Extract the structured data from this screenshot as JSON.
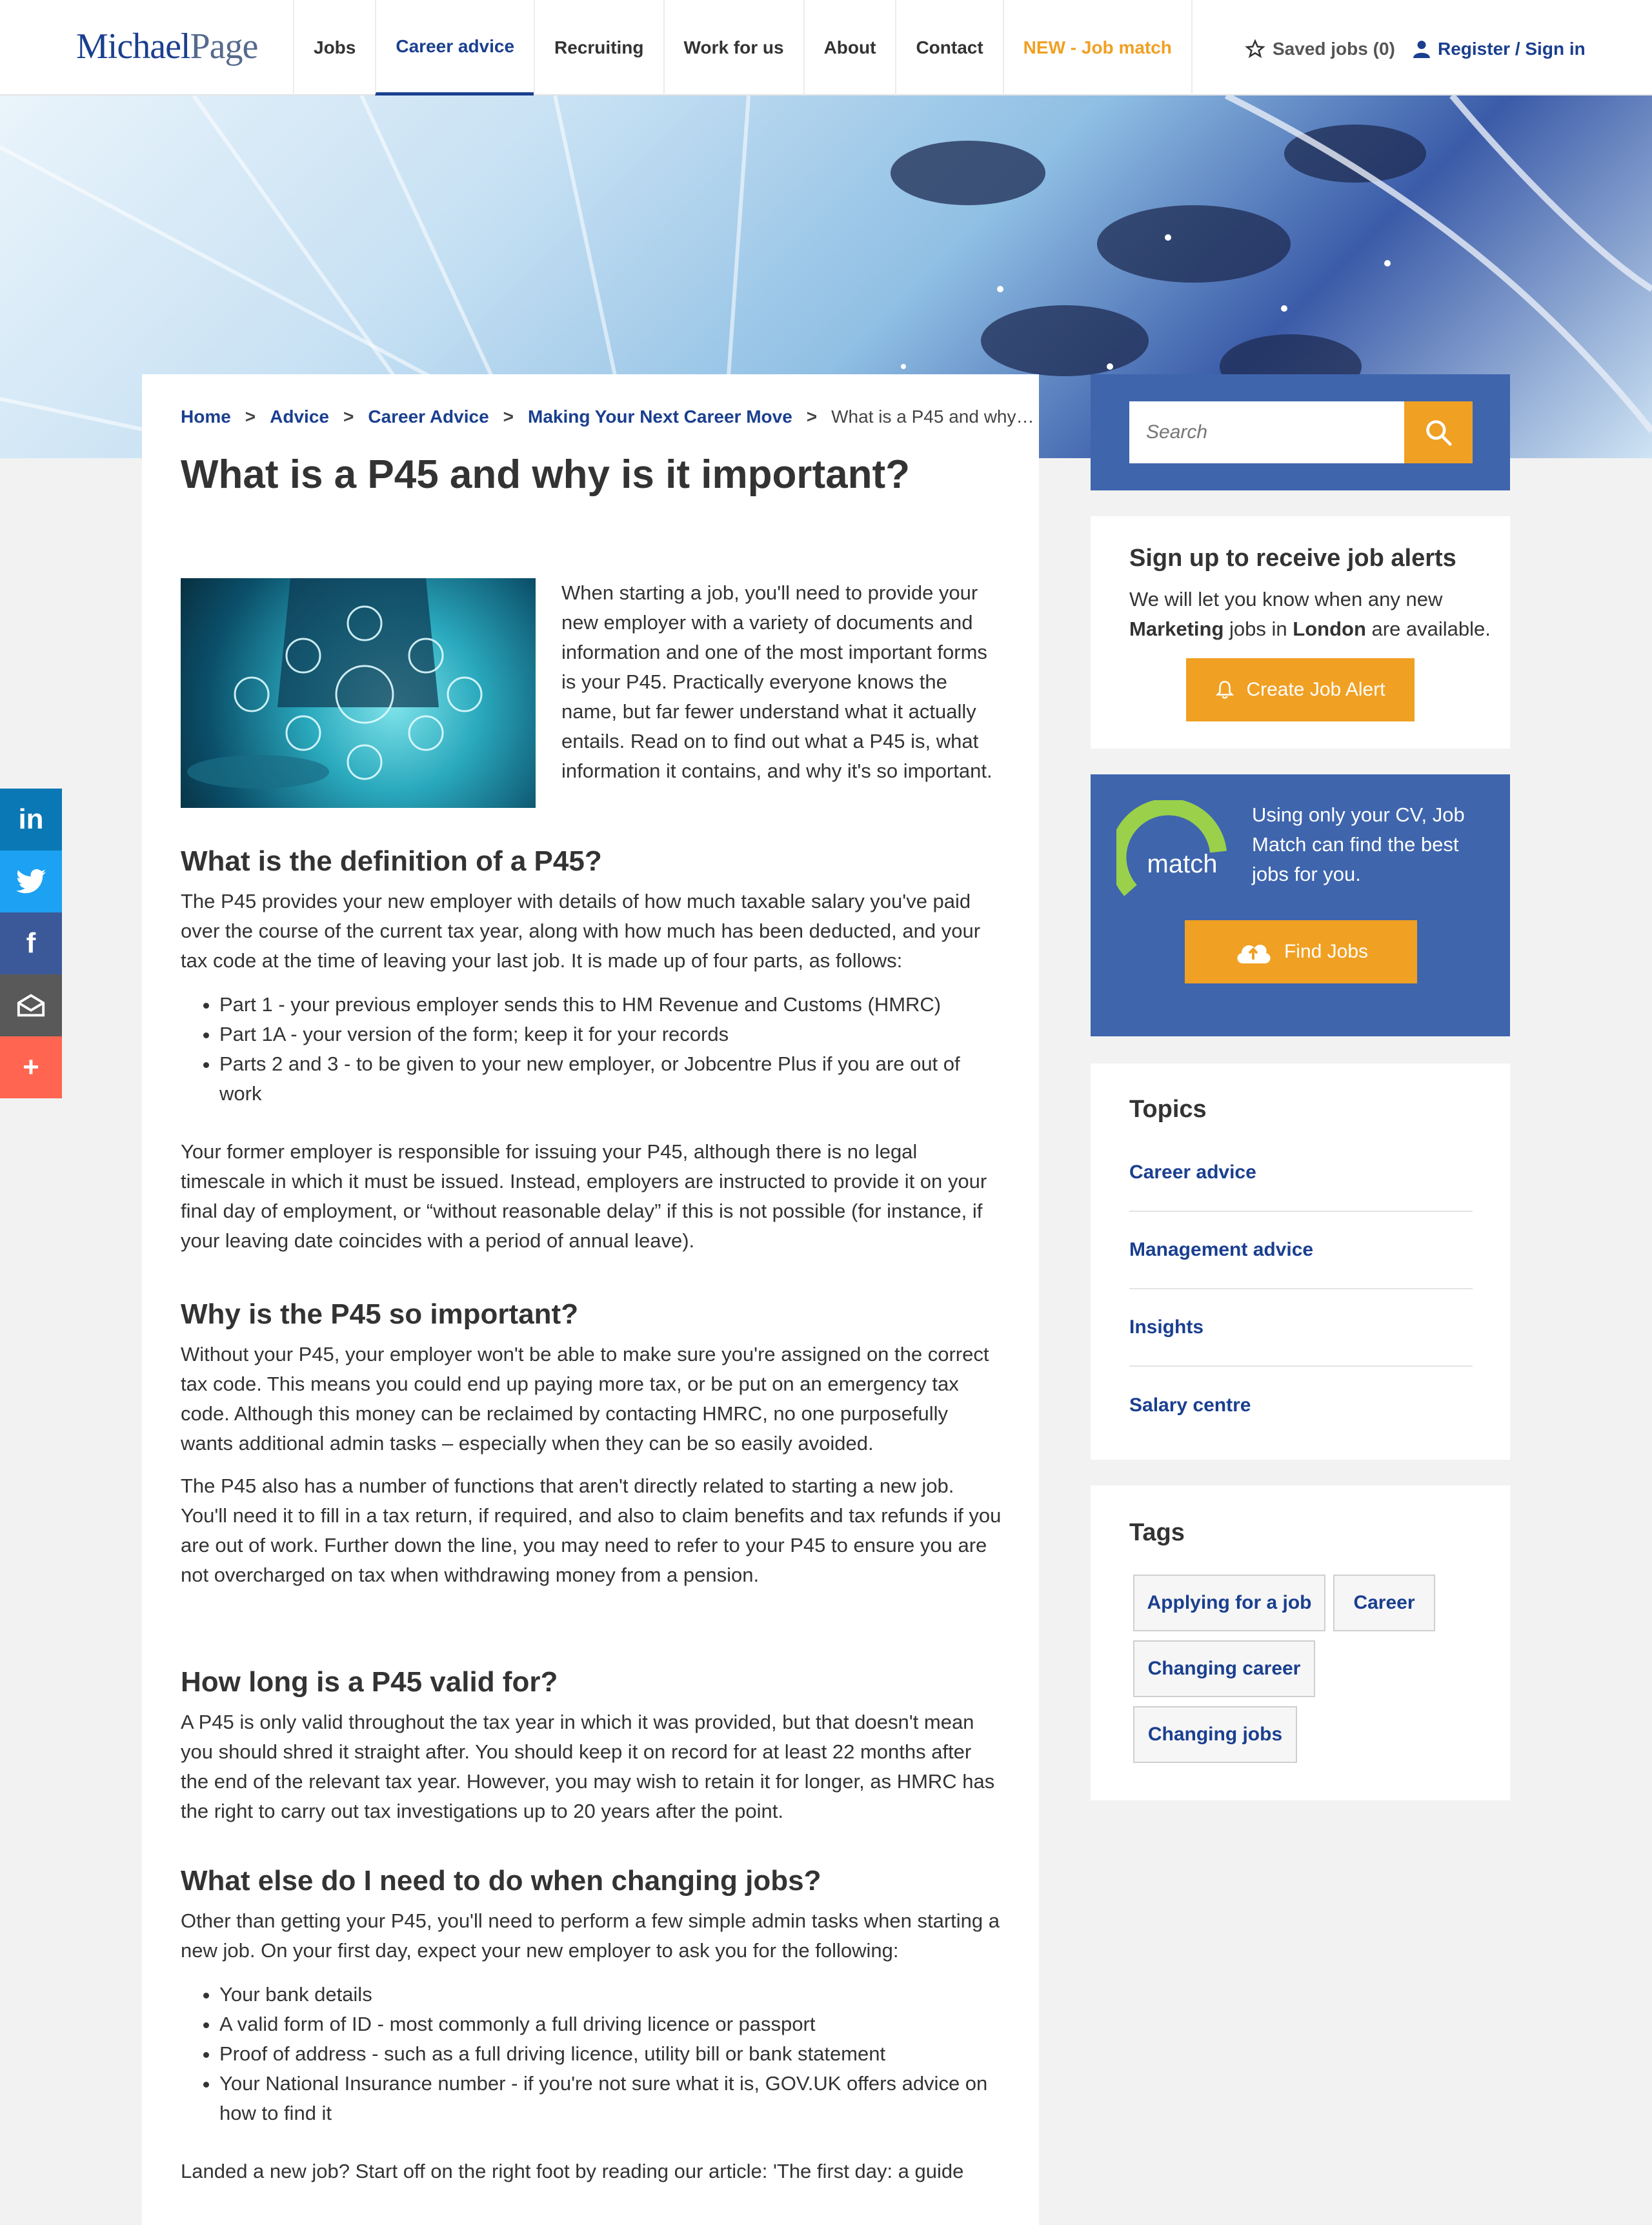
{
  "header": {
    "logo_michael": "Michael",
    "logo_page": "Page",
    "nav": [
      "Jobs",
      "Career advice",
      "Recruiting",
      "Work for us",
      "About",
      "Contact",
      "NEW - Job match"
    ],
    "saved_jobs": "Saved jobs (0)",
    "register": "Register / Sign in"
  },
  "breadcrumb": {
    "items": [
      "Home",
      "Advice",
      "Career Advice",
      "Making Your Next Career Move"
    ],
    "separator": ">",
    "current": "What is a P45 and why…"
  },
  "article": {
    "title": "What is a P45 and why is it important?",
    "intro": "When starting a job, you'll need to provide your new employer with a variety of documents and information and one of the most important forms is your P45. Practically everyone knows the name, but far fewer understand what it actually entails. Read on to find out what a P45 is, what information it contains, and why it's so important.",
    "s1_title": "What is the definition of a P45?",
    "s1_p1": "The P45 provides your new employer with details of how much taxable salary you've paid over the course of the current tax year, along with how much has been deducted, and your tax code at the time of leaving your last job. It is made up of four parts, as follows:",
    "s1_list": [
      "Part 1 - your previous employer sends this to HM Revenue and Customs (HMRC)",
      "Part 1A - your version of the form; keep it for your records",
      "Parts 2 and 3 - to be given to your new employer, or Jobcentre Plus if you are out of work"
    ],
    "s1_p2": "Your former employer is responsible for issuing your P45, although there is no legal timescale in which it must be issued. Instead, employers are instructed to provide it on your final day of employment, or “without reasonable delay” if this is not possible (for instance, if your leaving date coincides with a period of annual leave).",
    "s2_title": "Why is the P45 so important?",
    "s2_p1": "Without your P45, your employer won't be able to make sure you're assigned on the correct tax code. This means you could end up paying more tax, or be put on an emergency tax code. Although this money can be reclaimed by contacting HMRC, no one purposefully wants additional admin tasks – especially when they can be so easily avoided.",
    "s2_p2": "The P45 also has a number of functions that aren't directly related to starting a new job. You'll need it to fill in a tax return, if required, and also to claim benefits and tax refunds if you are out of work. Further down the line, you may need to refer to your P45 to ensure you are not overcharged on tax when withdrawing money from a pension.",
    "s3_title": "How long is a P45 valid for?",
    "s3_p1": "A P45 is only valid throughout the tax year in which it was provided, but that doesn't mean you should shred it straight after. You should keep it on record for at least 22 months after the end of the relevant tax year. However, you may wish to retain it for longer, as HMRC has the right to carry out tax investigations up to 20 years after the point.",
    "s4_title": "What else do I need to do when changing jobs?",
    "s4_p1": "Other than getting your P45, you'll need to perform a few simple admin tasks when starting a new job. On your first day, expect your new employer to ask you for the following:",
    "s4_list": [
      "Your bank details",
      "A valid form of ID - most commonly a full driving licence or passport",
      "Proof of address - such as a full driving licence, utility bill or bank statement",
      "Your National Insurance number - if you're not sure what it is, GOV.UK offers advice on how to find it"
    ],
    "s4_p2": "Landed a new job? Start off on the right foot by reading our article: 'The first day: a guide"
  },
  "sidebar": {
    "search_placeholder": "Search",
    "alerts_title": "Sign up to receive job alerts",
    "alerts_text_1": "We will let you know when any new ",
    "alerts_keyword": "Marketing",
    "alerts_text_2": " jobs in ",
    "alerts_location": "London",
    "alerts_text_3": " are available.",
    "alerts_button": "Create Job Alert",
    "match_logo_text": "match",
    "match_text": "Using only your CV, Job Match can find the best jobs for you.",
    "match_button": "Find Jobs",
    "topics_title": "Topics",
    "topics": [
      "Career advice",
      "Management advice",
      "Insights",
      "Salary centre"
    ],
    "tags_title": "Tags",
    "tags": [
      "Applying for a job",
      "Career",
      "Changing career",
      "Changing jobs"
    ]
  },
  "social": [
    "linkedin-icon",
    "twitter-icon",
    "facebook-icon",
    "email-icon",
    "plus-icon"
  ],
  "colors": {
    "brand_blue": "#1a3f8f",
    "accent_orange": "#f0a023",
    "panel_blue": "#3f65ad",
    "linkedin": "#0a78b5",
    "twitter": "#1da1f2",
    "facebook": "#3b5998",
    "email": "#595959",
    "share": "#ff6550"
  }
}
